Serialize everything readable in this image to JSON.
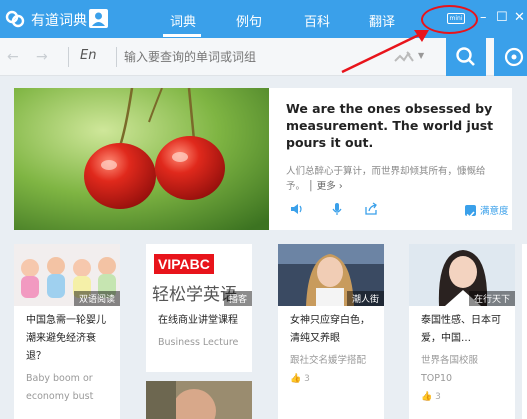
{
  "titlebar": {
    "app_title": "有道词典",
    "tabs": [
      "词典",
      "例句",
      "百科",
      "翻译"
    ],
    "mini_badge": "mini"
  },
  "searchbar": {
    "lang": "En",
    "placeholder": "输入要查询的单词或词组"
  },
  "daily": {
    "quote": "We are the ones obsessed by measurement. The world just pours it out.",
    "translation": "人们总醉心于算计，而世界却倾其所有，慷慨给予。",
    "more": "更多",
    "checkbox_label": "满意度"
  },
  "cards": [
    {
      "tag": "双语阅读",
      "title": "中国急需一轮婴儿潮来避免经济衰退？",
      "subtitle": "Baby boom or economy bust",
      "likes": ""
    },
    {
      "tag": "播客",
      "logo_text": "VIPABC",
      "logo_sub": "轻松学英语",
      "title": "在线商业讲堂课程",
      "subtitle": "Business Lecture",
      "likes": ""
    },
    {
      "tag": "潮人街",
      "title": "女神只应穿白色，清纯又养眼",
      "subtitle": "跟社交名媛学搭配",
      "likes": "3"
    },
    {
      "tag": "在行天下",
      "title": "泰国性感、日本可爱，中国…",
      "subtitle": "世界各国校服TOP10",
      "likes": "3"
    }
  ],
  "colors": {
    "accent": "#3aa0ea",
    "annotation": "#e8141b"
  }
}
